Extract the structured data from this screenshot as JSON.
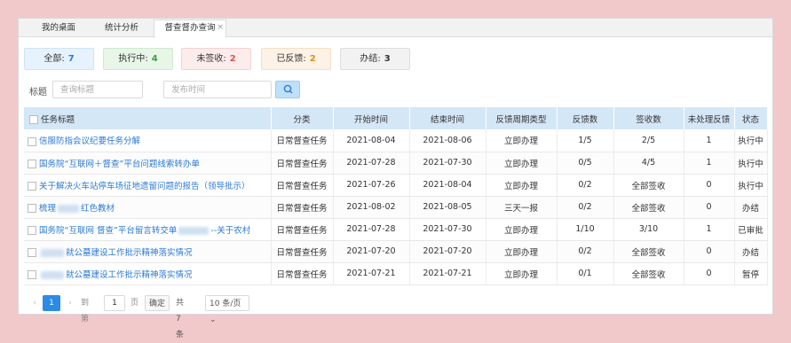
{
  "tabs": [
    {
      "label": "我的桌面"
    },
    {
      "label": "统计分析"
    },
    {
      "label": "督查督办查询",
      "active": true
    }
  ],
  "summary": [
    {
      "label": "全部:",
      "count": "7",
      "bg": "#e6f2fd",
      "border": "#d0e4f7",
      "color": "#2b7ad6"
    },
    {
      "label": "执行中:",
      "count": "4",
      "bg": "#e8f6e8",
      "border": "#cfe9cf",
      "color": "#3aa13a"
    },
    {
      "label": "未签收:",
      "count": "2",
      "bg": "#fdecec",
      "border": "#f5d2d2",
      "color": "#d9534f"
    },
    {
      "label": "已反馈:",
      "count": "2",
      "bg": "#fdf2e6",
      "border": "#f5e0c6",
      "color": "#e08a1e"
    },
    {
      "label": "办结:",
      "count": "3",
      "bg": "#f2f2f2",
      "border": "#dedede",
      "color": "#333333"
    }
  ],
  "search": {
    "label": "标题",
    "title_placeholder": "查询标题",
    "date_placeholder": "发布时间",
    "search_icon": "search-icon"
  },
  "table": {
    "columns": [
      "任务标题",
      "分类",
      "开始时间",
      "结束时间",
      "反馈周期类型",
      "反馈数",
      "签收数",
      "未处理反馈",
      "状态"
    ],
    "rows": [
      {
        "title": "信服防指会议纪要任务分解",
        "category": "日常督查任务",
        "start": "2021-08-04",
        "end": "2021-08-06",
        "cycle": "立即办理",
        "feedback": "1/5",
        "signed": "2/5",
        "pending": "1",
        "status": "执行中"
      },
      {
        "title": "国务院“互联网＋督查”平台问题线索转办单",
        "category": "日常督查任务",
        "start": "2021-07-28",
        "end": "2021-07-30",
        "cycle": "立即办理",
        "feedback": "0/5",
        "signed": "4/5",
        "pending": "1",
        "status": "执行中"
      },
      {
        "title": "关于解决火车站停车场征地遗留问题的报告（领导批示）",
        "category": "日常督查任务",
        "start": "2021-07-26",
        "end": "2021-08-04",
        "cycle": "立即办理",
        "feedback": "0/2",
        "signed": "全部签收",
        "pending": "0",
        "status": "执行中"
      },
      {
        "title_pre": "梳理",
        "title_post": "红色教材",
        "category": "日常督查任务",
        "start": "2021-08-02",
        "end": "2021-08-05",
        "cycle": "三天一报",
        "feedback": "0/2",
        "signed": "全部签收",
        "pending": "0",
        "status": "办结"
      },
      {
        "title_pre": "国务院“互联网 督查”平台留言转交单",
        "title_post": "--关于农村",
        "category": "日常督查任务",
        "start": "2021-07-28",
        "end": "2021-07-30",
        "cycle": "立即办理",
        "feedback": "1/10",
        "signed": "3/10",
        "pending": "1",
        "status": "已审批"
      },
      {
        "title_pre": "",
        "title_post": "就公墓建设工作批示精神落实情况",
        "category": "日常督查任务",
        "start": "2021-07-20",
        "end": "2021-07-20",
        "cycle": "立即办理",
        "feedback": "0/2",
        "signed": "全部签收",
        "pending": "0",
        "status": "办结"
      },
      {
        "title_pre": "",
        "title_post": "就公墓建设工作批示精神落实情况",
        "category": "日常督查任务",
        "start": "2021-07-21",
        "end": "2021-07-21",
        "cycle": "立即办理",
        "feedback": "0/1",
        "signed": "全部签收",
        "pending": "0",
        "status": "暂停"
      }
    ]
  },
  "pager": {
    "current": "1",
    "goto_label": "到第",
    "goto_value": "1",
    "page_unit": "页",
    "confirm": "确定",
    "total": "共 7 条",
    "page_size": "10 条/页"
  }
}
